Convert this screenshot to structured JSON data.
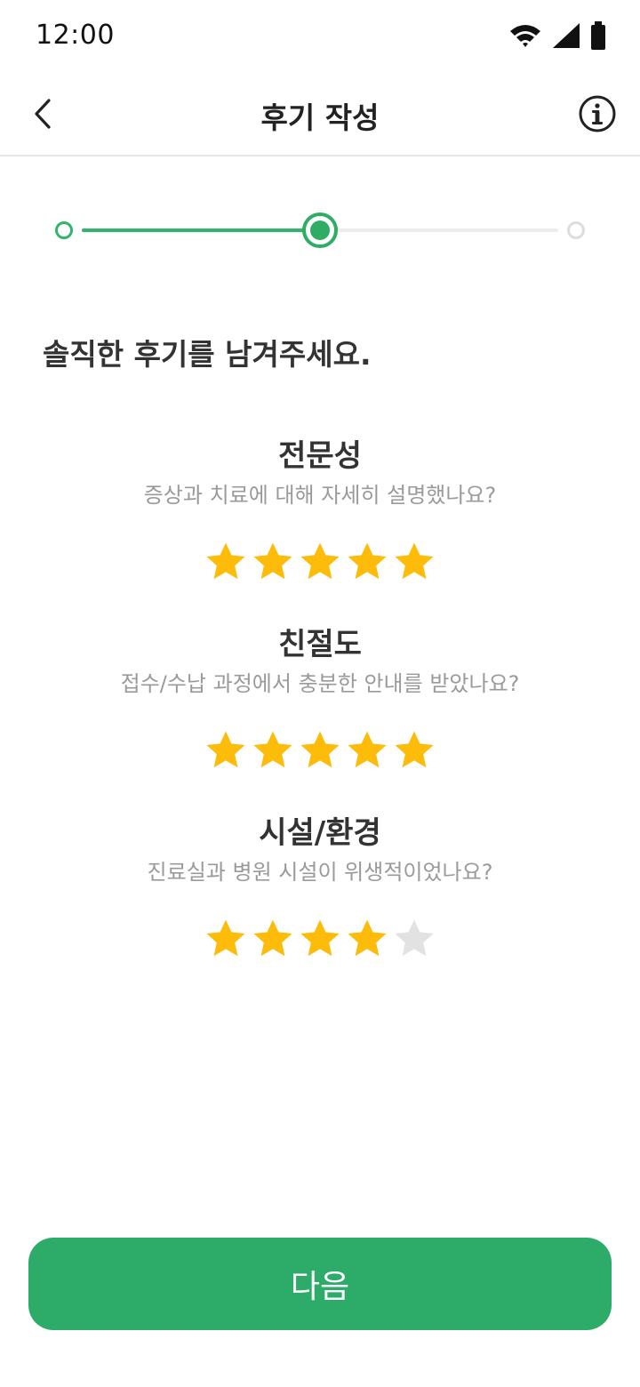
{
  "status_bar": {
    "time": "12:00",
    "icons": [
      "wifi-icon",
      "signal-icon",
      "battery-icon"
    ]
  },
  "header": {
    "back_icon": "chevron-left-icon",
    "title": "후기 작성",
    "info_icon": "info-icon"
  },
  "stepper": {
    "total_steps": 3,
    "current_step": 2
  },
  "prompt": "솔직한 후기를 남겨주세요.",
  "ratings": [
    {
      "title": "전문성",
      "subtitle": "증상과 치료에 대해 자세히 설명했나요?",
      "value": 5,
      "max": 5
    },
    {
      "title": "친절도",
      "subtitle": "접수/수납 과정에서 충분한 안내를 받았나요?",
      "value": 5,
      "max": 5
    },
    {
      "title": "시설/환경",
      "subtitle": "진료실과 병원 시설이 위생적이었나요?",
      "value": 4,
      "max": 5
    }
  ],
  "next_button": {
    "label": "다음"
  },
  "colors": {
    "accent": "#2dac69",
    "star_filled": "#fdbc09",
    "star_empty": "#e2e2e2",
    "subtitle_text": "#9a9a9a"
  }
}
